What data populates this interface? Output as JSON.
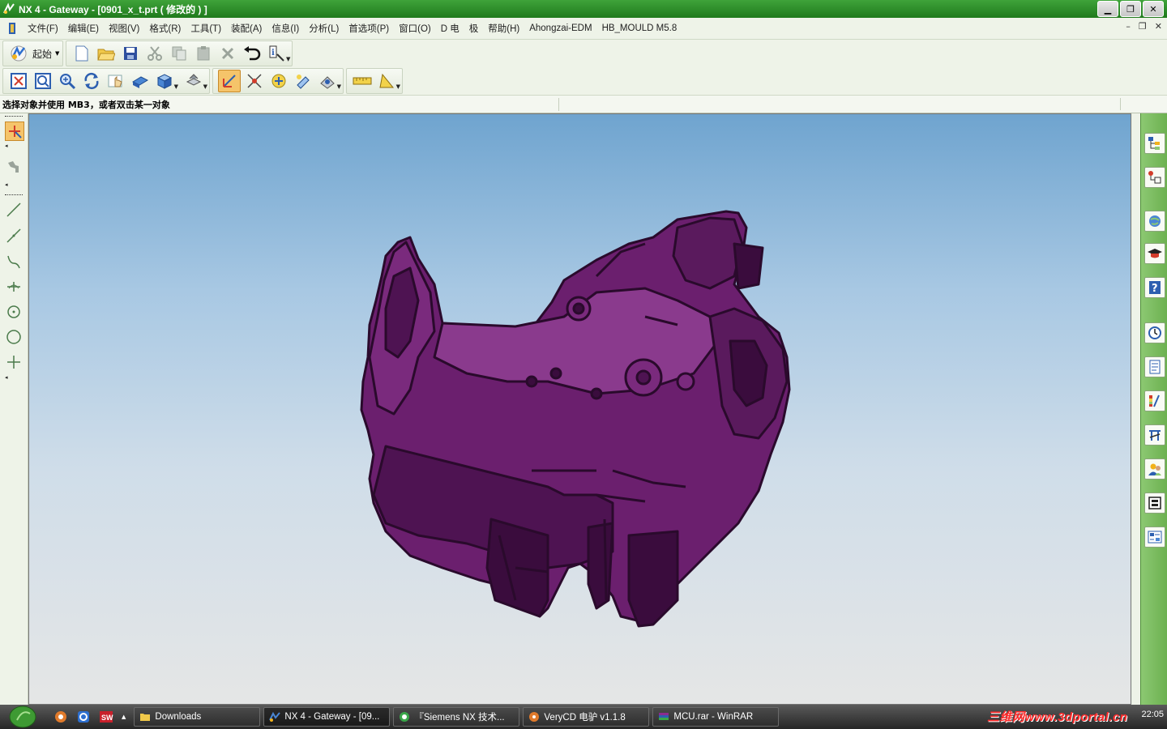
{
  "window": {
    "title": "NX 4 - Gateway - [0901_x_t.prt ( 修改的 ) ]",
    "controls": [
      "minimize-icon",
      "restore-icon",
      "close-icon"
    ]
  },
  "menu": {
    "items": [
      "文件(F)",
      "编辑(E)",
      "视图(V)",
      "格式(R)",
      "工具(T)",
      "装配(A)",
      "信息(I)",
      "分析(L)",
      "首选项(P)",
      "窗口(O)",
      "D 电",
      "极",
      "帮助(H)",
      "Ahongzai-EDM",
      "HB_MOULD M5.8"
    ]
  },
  "toolbar": {
    "start_label": "起始",
    "row1_icons": [
      "new-file-icon",
      "open-folder-icon",
      "save-icon",
      "cut-icon",
      "copy-icon",
      "paste-icon",
      "delete-icon",
      "undo-icon",
      "information-icon"
    ],
    "row2_icons": [
      "fit-view-icon",
      "zoom-window-icon",
      "zoom-icon",
      "rotate-icon",
      "pan-icon",
      "render-style-icon",
      "orient-view-icon",
      "layer-icon",
      "selection-filter-icon",
      "snap-point-icon",
      "wcs-icon",
      "edit-object-icon",
      "display-edit-icon",
      "measure-distance-icon",
      "measure-angle-icon"
    ]
  },
  "cue": {
    "text": "选择对象并使用 MB3，或者双击某一对象"
  },
  "leftbar": {
    "icons": [
      "select-icon",
      "feature-icon",
      "line-icon",
      "line-segment-icon",
      "arc-icon",
      "point-cross-icon",
      "circle-point-icon",
      "circle-icon",
      "point-icon"
    ]
  },
  "resource_bar": {
    "icons": [
      "assembly-navigator-icon",
      "part-navigator-icon",
      "web-browser-icon",
      "training-icon",
      "help-icon",
      "history-icon",
      "system-materials-icon",
      "palette-icon",
      "tool-library-icon",
      "roles-icon",
      "reuse-library-icon",
      "process-studio-icon"
    ]
  },
  "taskbar": {
    "tasks": [
      {
        "label": "Downloads",
        "icon": "folder-icon"
      },
      {
        "label": "NX 4 - Gateway - [09...",
        "icon": "nx-icon"
      },
      {
        "label": "『Siemens NX 技术...",
        "icon": "browser-icon"
      },
      {
        "label": "VeryCD 电驴 v1.1.8",
        "icon": "emule-icon"
      },
      {
        "label": "MCU.rar - WinRAR",
        "icon": "winrar-icon"
      }
    ],
    "clock": "22:05",
    "watermark": "三维网www.3dportal.cn"
  },
  "colors": {
    "title_green": "#2d8f29",
    "model_purple": "#6b1f6e",
    "viewport_top": "#6fa4cf",
    "viewport_bottom": "#e5e6e6"
  }
}
